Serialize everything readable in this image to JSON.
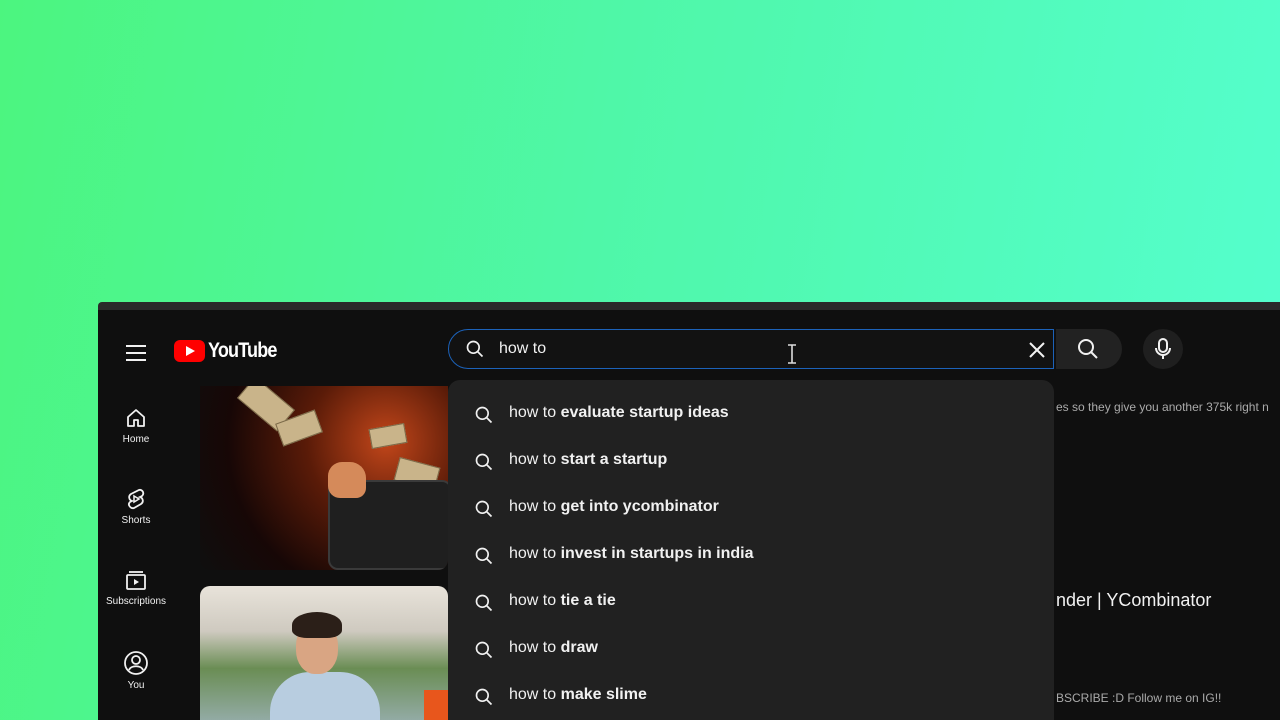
{
  "logo": {
    "wordmark": "YouTube"
  },
  "search": {
    "value": "how to "
  },
  "sidebar": {
    "items": [
      {
        "label": "Home",
        "icon": "home-icon"
      },
      {
        "label": "Shorts",
        "icon": "shorts-icon"
      },
      {
        "label": "Subscriptions",
        "icon": "subscriptions-icon"
      },
      {
        "label": "You",
        "icon": "you-icon"
      }
    ]
  },
  "suggestions": [
    {
      "query": "how to",
      "completion": " evaluate startup ideas"
    },
    {
      "query": "how to",
      "completion": " start a startup"
    },
    {
      "query": "how to",
      "completion": " get into ycombinator"
    },
    {
      "query": "how to",
      "completion": " invest in startups in india"
    },
    {
      "query": "how to",
      "completion": " tie a tie"
    },
    {
      "query": "how to",
      "completion": " draw"
    },
    {
      "query": "how to",
      "completion": " make slime"
    }
  ],
  "feed": {
    "video1_desc_fragment": "es so they give you another 375k right n",
    "video2_title_fragment": "nder | YCombinator",
    "video2_desc_fragment": "BSCRIBE :D Follow me on IG!!"
  },
  "colors": {
    "background_gradient": [
      "#4cf57f",
      "#55ffd0"
    ],
    "app_bg": "#0f0f0f",
    "dropdown_bg": "#212121",
    "focus_border": "#1c62b9",
    "logo_red": "#ff0000"
  }
}
